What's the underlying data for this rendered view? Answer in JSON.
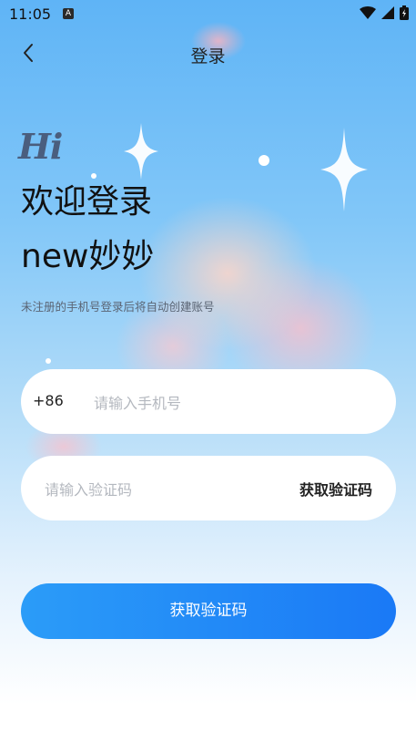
{
  "status_bar": {
    "time": "11:05",
    "badge": "A"
  },
  "header": {
    "title": "登录"
  },
  "hero": {
    "greeting": "Hi",
    "welcome": "欢迎登录",
    "app_name": "new妙妙",
    "hint": "未注册的手机号登录后将自动创建账号"
  },
  "phone_field": {
    "prefix": "+86",
    "placeholder": "请输入手机号",
    "value": ""
  },
  "code_field": {
    "placeholder": "请输入验证码",
    "value": "",
    "get_code_label": "获取验证码"
  },
  "submit": {
    "label": "获取验证码"
  },
  "colors": {
    "accent_start": "#2b9cf8",
    "accent_end": "#1a79f6"
  },
  "icons": [
    "back-arrow-icon",
    "wifi-icon",
    "signal-icon",
    "battery-icon",
    "sparkle-icon"
  ]
}
